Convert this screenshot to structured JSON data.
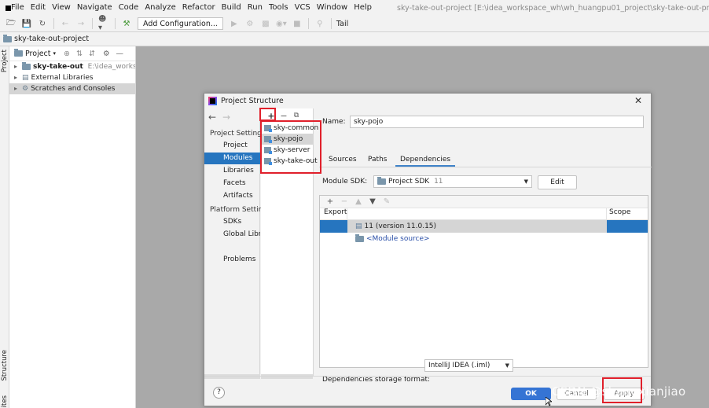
{
  "menubar": {
    "items": [
      "File",
      "Edit",
      "View",
      "Navigate",
      "Code",
      "Analyze",
      "Refactor",
      "Build",
      "Run",
      "Tools",
      "VCS",
      "Window",
      "Help"
    ],
    "window_title": "sky-take-out-project [E:\\idea_workspace_wh\\wh_huangpu01_project\\sky-take-out-project]"
  },
  "toolbar": {
    "add_config_label": "Add Configuration...",
    "tail_label": "Tail"
  },
  "navbar": {
    "project_name": "sky-take-out-project"
  },
  "left_stripe": {
    "project_label": "Project",
    "structure_label": "Structure",
    "favorites_label": "ites"
  },
  "project_panel": {
    "header_label": "Project",
    "tree": [
      {
        "label": "sky-take-out",
        "path": "E:\\idea_workspac"
      },
      {
        "label": "External Libraries"
      },
      {
        "label": "Scratches and Consoles"
      }
    ]
  },
  "dialog": {
    "title": "Project Structure",
    "nav": {
      "project_settings_header": "Project Settings",
      "project_settings_items": [
        "Project",
        "Modules",
        "Libraries",
        "Facets",
        "Artifacts"
      ],
      "platform_settings_header": "Platform Setting",
      "platform_settings_items": [
        "SDKs",
        "Global Librar"
      ],
      "problems_label": "Problems",
      "selected": "Modules"
    },
    "modules": [
      "sky-common",
      "sky-pojo",
      "sky-server",
      "sky-take-out"
    ],
    "selected_module": "sky-pojo",
    "name_label": "Name:",
    "name_value": "sky-pojo",
    "tabs": [
      "Sources",
      "Paths",
      "Dependencies"
    ],
    "active_tab": "Dependencies",
    "module_sdk_label": "Module SDK:",
    "module_sdk_value": "Project SDK",
    "module_sdk_version": "11",
    "edit_label": "Edit",
    "deps_columns": {
      "export": "Export",
      "scope": "Scope"
    },
    "deps_rows": [
      {
        "label": "11 (version 11.0.15)"
      },
      {
        "label": "<Module source>"
      }
    ],
    "storage_label": "Dependencies storage format:",
    "storage_value": "IntelliJ IDEA (.iml)",
    "help_label": "?",
    "ok_label": "OK",
    "cancel_label": "Cancel",
    "apply_label": "Apply"
  },
  "colors": {
    "accent": "#2675bf",
    "highlight_box": "#e0202b",
    "ok_button": "#3574d4"
  },
  "watermark": "CSDN @shangxianjiao"
}
